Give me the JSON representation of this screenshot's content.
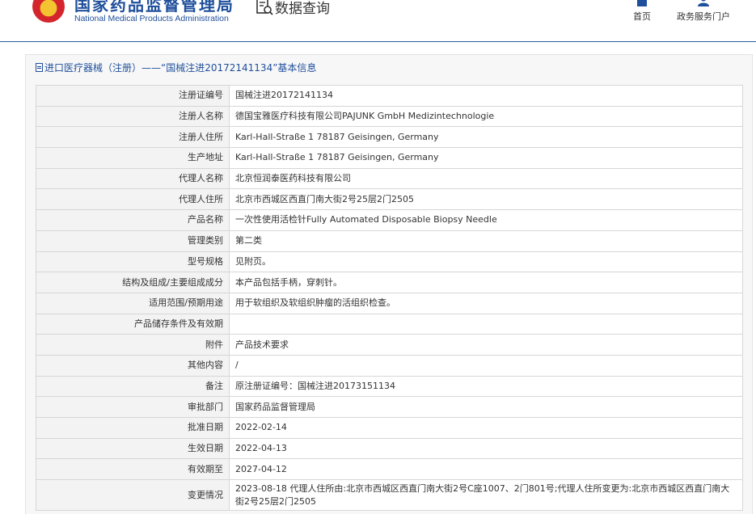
{
  "header": {
    "title_cn": "国家药品监督管理局",
    "title_en": "National Medical Products Administration",
    "query_label": "数据查询",
    "nav": {
      "home": "首页",
      "portal": "政务服务门户"
    }
  },
  "panel": {
    "title": "进口医疗器械（注册）——“国械注进20172141134”基本信息"
  },
  "rows": [
    {
      "label": "注册证编号",
      "value": "国械注进20172141134"
    },
    {
      "label": "注册人名称",
      "value": "德国宝雅医疗科技有限公司PAJUNK GmbH Medizintechnologie"
    },
    {
      "label": "注册人住所",
      "value": "Karl-Hall-Straße 1 78187 Geisingen, Germany"
    },
    {
      "label": "生产地址",
      "value": "Karl-Hall-Straße 1 78187 Geisingen, Germany"
    },
    {
      "label": "代理人名称",
      "value": "北京恒润泰医药科技有限公司"
    },
    {
      "label": "代理人住所",
      "value": "北京市西城区西直门南大街2号25层2门2505"
    },
    {
      "label": "产品名称",
      "value": "一次性使用活检针Fully Automated Disposable Biopsy Needle"
    },
    {
      "label": "管理类别",
      "value": "第二类"
    },
    {
      "label": "型号规格",
      "value": "见附页。"
    },
    {
      "label": "结构及组成/主要组成成分",
      "value": "本产品包括手柄，穿刺针。"
    },
    {
      "label": "适用范围/预期用途",
      "value": "用于软组织及软组织肿瘤的活组织检查。"
    },
    {
      "label": "产品储存条件及有效期",
      "value": ""
    },
    {
      "label": "附件",
      "value": "产品技术要求"
    },
    {
      "label": "其他内容",
      "value": "/"
    },
    {
      "label": "备注",
      "value": "原注册证编号：国械注进20173151134"
    },
    {
      "label": "审批部门",
      "value": "国家药品监督管理局"
    },
    {
      "label": "批准日期",
      "value": "2022-02-14"
    },
    {
      "label": "生效日期",
      "value": "2022-04-13"
    },
    {
      "label": "有效期至",
      "value": "2027-04-12"
    },
    {
      "label": "变更情况",
      "value": "2023-08-18 代理人住所由:北京市西城区西直门南大街2号C座1007、2门801号;代理人住所变更为:北京市西城区西直门南大街2号25层2门2505"
    }
  ],
  "colors": {
    "brand_blue": "#1f4f9b",
    "emblem_red": "#d4252c",
    "emblem_gold": "#f4c430"
  },
  "icons": [
    "emblem-icon",
    "data-query-icon",
    "home-icon",
    "user-icon",
    "document-icon"
  ]
}
